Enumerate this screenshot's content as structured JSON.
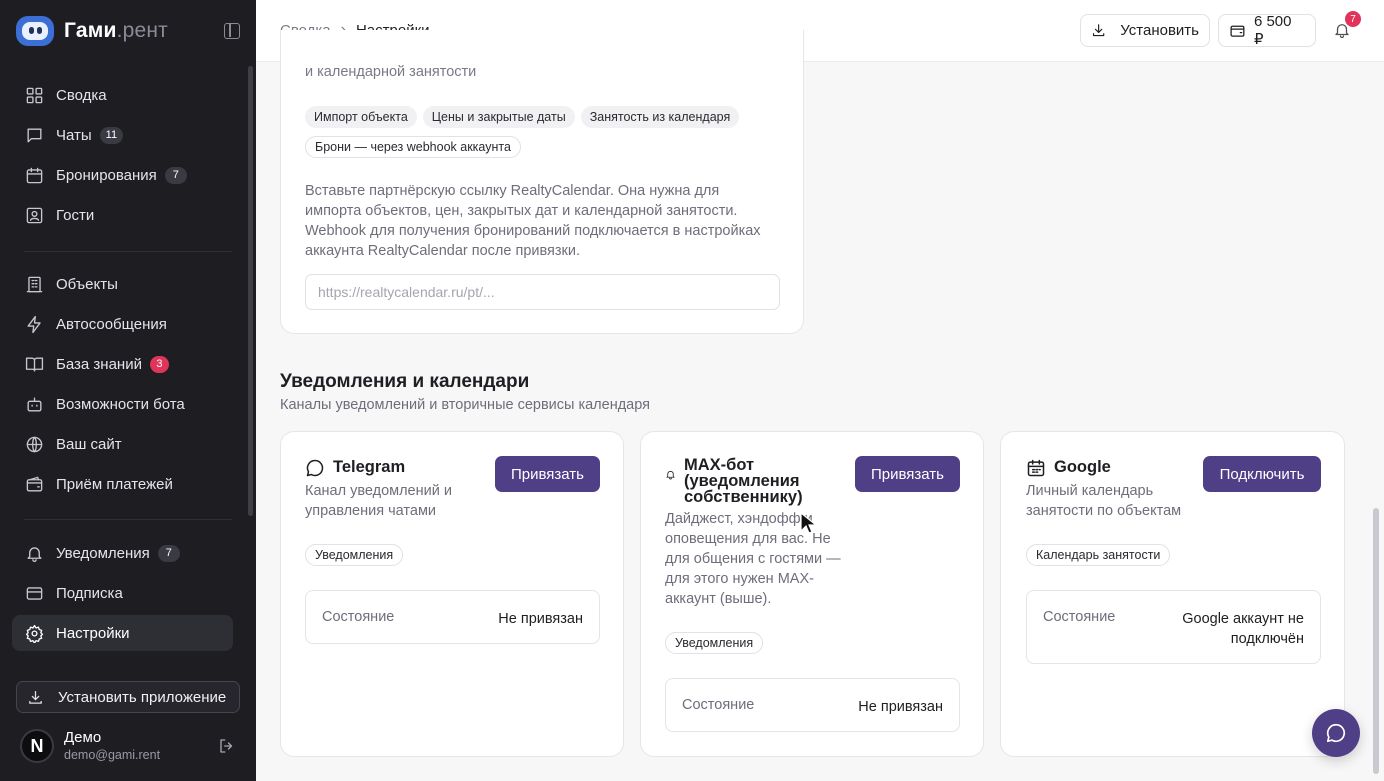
{
  "app": {
    "brand_main": "Гами",
    "brand_suffix": ".рент"
  },
  "sidebar": {
    "items": [
      {
        "label": "Сводка",
        "icon": "dashboard-icon",
        "badge": ""
      },
      {
        "label": "Чаты",
        "icon": "chat-icon",
        "badge": "11"
      },
      {
        "label": "Бронирования",
        "icon": "calendar-icon",
        "badge": "7"
      },
      {
        "label": "Гости",
        "icon": "guest-icon",
        "badge": ""
      },
      {
        "label": "Объекты",
        "icon": "building-icon",
        "badge": ""
      },
      {
        "label": "Автосообщения",
        "icon": "lightning-icon",
        "badge": ""
      },
      {
        "label": "База знаний",
        "icon": "book-icon",
        "badge": "3"
      },
      {
        "label": "Возможности бота",
        "icon": "bot-icon",
        "badge": ""
      },
      {
        "label": "Ваш сайт",
        "icon": "globe-icon",
        "badge": ""
      },
      {
        "label": "Приём платежей",
        "icon": "wallet-icon",
        "badge": ""
      },
      {
        "label": "Уведомления",
        "icon": "bell-icon",
        "badge": "7"
      },
      {
        "label": "Подписка",
        "icon": "card-icon",
        "badge": ""
      },
      {
        "label": "Настройки",
        "icon": "gear-icon",
        "badge": ""
      }
    ],
    "install_label": "Установить приложение",
    "user": {
      "initial": "N",
      "name": "Демо",
      "email": "demo@gami.rent"
    }
  },
  "header": {
    "breadcrumb": [
      "Сводка",
      "Настройки"
    ],
    "install_label": "Установить",
    "balance": "6 500 ₽",
    "notifications_count": "7"
  },
  "realty": {
    "subtitle_tail": "и календарной занятости",
    "tags": [
      "Импорт объекта",
      "Цены и закрытые даты",
      "Занятость из календаря",
      "Брони — через webhook аккаунта"
    ],
    "description": "Вставьте партнёрскую ссылку RealtyCalendar. Она нужна для импорта объектов, цен, закрытых дат и календарной занятости. Webhook для получения бронирований подключается в настройках аккаунта RealtyCalendar после привязки.",
    "url_placeholder": "https://realtycalendar.ru/pt/..."
  },
  "notifications_section": {
    "title": "Уведомления и календари",
    "subtitle": "Каналы уведомлений и вторичные сервисы календаря",
    "channels": [
      {
        "title": "Telegram",
        "icon": "chat-bubble-icon",
        "desc": "Канал уведомлений и управления чатами",
        "button": "Привязать",
        "tag": "Уведомления",
        "status_label": "Состояние",
        "status_value": "Не привязан"
      },
      {
        "title": "MAX-бот (уведомления собственнику)",
        "icon": "bell-small-icon",
        "desc": "Дайджест, хэндофф и оповещения для вас. Не для общения с гостями — для этого нужен MAX-аккаунт (выше).",
        "button": "Привязать",
        "tag": "Уведомления",
        "status_label": "Состояние",
        "status_value": "Не привязан"
      },
      {
        "title": "Google",
        "icon": "calendar-icon",
        "desc": "Личный календарь занятости по объектам",
        "button": "Подключить",
        "tag": "Календарь занятости",
        "status_label": "Состояние",
        "status_value": "Google аккаунт не подключён"
      }
    ]
  },
  "colors": {
    "primary": "#4f3f86",
    "sidebar_bg": "#1d1d22",
    "badge_red": "#e0345a"
  }
}
